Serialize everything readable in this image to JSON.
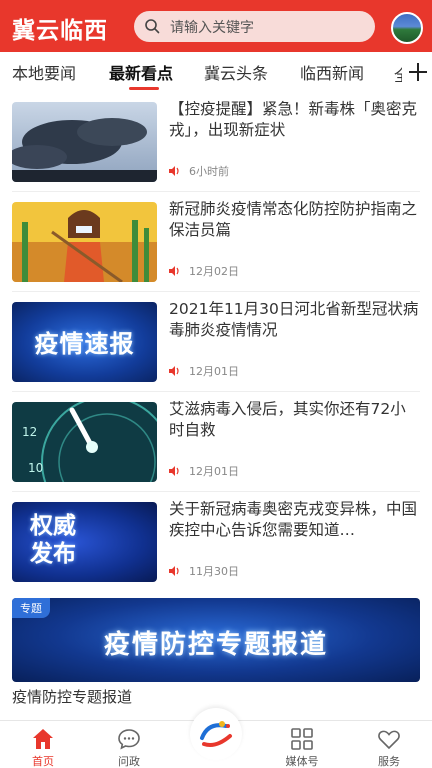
{
  "header": {
    "brand": "冀云临西",
    "search_placeholder": "请输入关键字"
  },
  "tabs": [
    {
      "label": "本地要闻",
      "active": false
    },
    {
      "label": "最新看点",
      "active": true
    },
    {
      "label": "冀云头条",
      "active": false
    },
    {
      "label": "临西新闻",
      "active": false
    },
    {
      "label": "全",
      "active": false
    }
  ],
  "feed": [
    {
      "title": "【控疫提醒】紧急！新毒株「奥密克戎」，出现新症状",
      "time": "6小时前"
    },
    {
      "title": "新冠肺炎疫情常态化防控防护指南之保洁员篇",
      "time": "12月02日"
    },
    {
      "title": "2021年11月30日河北省新型冠状病毒肺炎疫情情况",
      "time": "12月01日",
      "thumb_text": "疫情速报"
    },
    {
      "title": "艾滋病毒入侵后，其实你还有72小时自救",
      "time": "12月01日"
    },
    {
      "title": "关于新冠病毒奥密克戎变异株，中国疾控中心告诉您需要知道…",
      "time": "11月30日",
      "thumb_text": "权威发布"
    }
  ],
  "special": {
    "tag": "专题",
    "banner_title": "疫情防控专题报道",
    "caption": "疫情防控专题报道"
  },
  "bottom_nav": [
    {
      "label": "首页",
      "icon": "home-icon",
      "active": true
    },
    {
      "label": "问政",
      "icon": "chat-bubble-icon",
      "active": false
    },
    {
      "label": "",
      "icon": "center-logo-icon",
      "active": false
    },
    {
      "label": "媒体号",
      "icon": "grid-icon",
      "active": false
    },
    {
      "label": "服务",
      "icon": "heart-icon",
      "active": false
    }
  ],
  "colors": {
    "accent": "#e8372c",
    "blue_banner": "#12388f"
  }
}
